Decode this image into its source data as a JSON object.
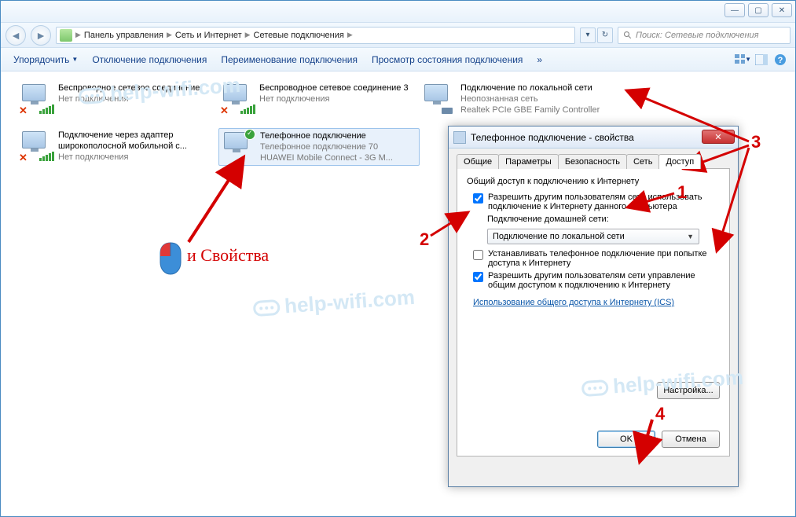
{
  "breadcrumbs": {
    "a": "Панель управления",
    "b": "Сеть и Интернет",
    "c": "Сетевые подключения"
  },
  "search": {
    "placeholder": "Поиск: Сетевые подключения"
  },
  "toolbar": {
    "organize": "Упорядочить",
    "disable": "Отключение подключения",
    "rename": "Переименование подключения",
    "status": "Просмотр состояния подключения"
  },
  "conns": {
    "c1": {
      "t1": "Беспроводное сетевое соединение",
      "t2": "Нет подключения"
    },
    "c2": {
      "t1": "Беспроводное сетевое соединение 3",
      "t2": "Нет подключения"
    },
    "c3": {
      "t1": "Подключение по локальной сети",
      "t2": "Неопознанная сеть",
      "t3": "Realtek PCIe GBE Family Controller"
    },
    "c4": {
      "t1": "Подключение через адаптер широкополосной мобильной с...",
      "t2": "Нет подключения"
    },
    "c5": {
      "t1": "Телефонное подключение",
      "t2": "Телефонное подключение 70",
      "t3": "HUAWEI Mobile Connect - 3G M..."
    }
  },
  "anno": {
    "props_label": "и Свойства",
    "n1": "1",
    "n2": "2",
    "n3": "3",
    "n4": "4"
  },
  "dialog": {
    "title": "Телефонное подключение - свойства",
    "tabs": {
      "general": "Общие",
      "params": "Параметры",
      "security": "Безопасность",
      "network": "Сеть",
      "access": "Доступ"
    },
    "section_title": "Общий доступ к подключению к Интернету",
    "opt1": "Разрешить другим пользователям сети использовать подключение к Интернету данного компьютера",
    "home_net_label": "Подключение домашней сети:",
    "home_net_value": "Подключение по локальной сети",
    "opt2": "Устанавливать телефонное подключение при попытке доступа к Интернету",
    "opt3": "Разрешить другим пользователям сети управление общим доступом к подключению к Интернету",
    "ics_link": "Использование общего доступа к Интернету (ICS)",
    "settings_btn": "Настройка...",
    "ok": "OK",
    "cancel": "Отмена"
  },
  "watermark": "help-wifi.com"
}
